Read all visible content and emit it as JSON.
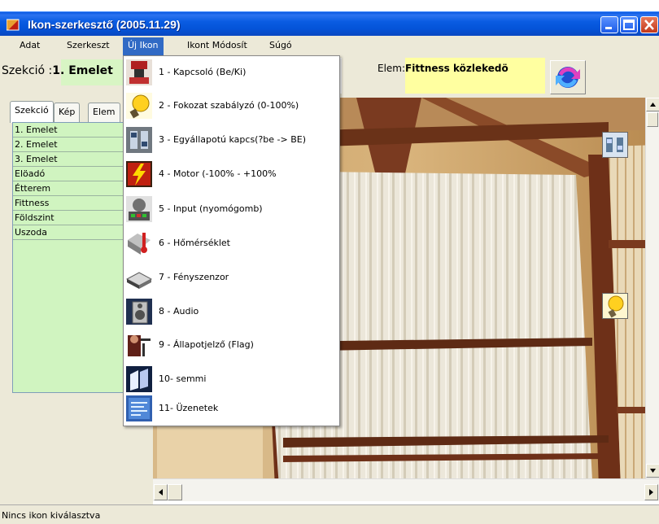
{
  "window": {
    "title": "Ikon-szerkesztő (2005.11.29)"
  },
  "menubar": {
    "items": [
      "Adat",
      "Szerkeszt",
      "Új Ikon",
      "Ikont Módosít",
      "Súgó"
    ]
  },
  "section": {
    "label": "Szekció :",
    "value": "1. Emelet"
  },
  "element": {
    "label": "Elem:",
    "value": "Fittness közlekedö"
  },
  "tabs": [
    "Szekció",
    "Kép",
    "Elem"
  ],
  "section_list": [
    "1. Emelet",
    "2. Emelet",
    "3. Emelet",
    "Elöadó",
    "Étterem",
    "Fittness",
    "Földszint",
    "Uszoda"
  ],
  "new_icon_menu": [
    {
      "label": "1 - Kapcsoló (Be/Ki)",
      "icon": "switch-icon"
    },
    {
      "label": "2 - Fokozat szabályzó (0-100%)",
      "icon": "dimmer-bulb-icon"
    },
    {
      "label": "3 - Egyállapotú kapcs(?be -> BE)",
      "icon": "single-state-switch-icon"
    },
    {
      "label": "4 - Motor (-100% - +100%",
      "icon": "motor-lightning-icon"
    },
    {
      "label": "5 - Input (nyomógomb)",
      "icon": "pushbutton-input-icon"
    },
    {
      "label": "6 - Hőmérséklet",
      "icon": "thermometer-icon"
    },
    {
      "label": "7 - Fényszenzor",
      "icon": "light-sensor-icon"
    },
    {
      "label": "8 - Audio",
      "icon": "speaker-icon"
    },
    {
      "label": "9 - Állapotjelző (Flag)",
      "icon": "flag-status-icon"
    },
    {
      "label": "10- semmi",
      "icon": "nothing-icon"
    },
    {
      "label": "11- Üzenetek",
      "icon": "messages-icon"
    }
  ],
  "status": {
    "text": "Nincs ikon kiválasztva"
  },
  "colors": {
    "titlebar": "#0a5ce2",
    "menu_highlight": "#316ac5",
    "section_box": "#d8f5c4",
    "element_box": "#ffffa0",
    "list_bg": "#d0f4c0"
  }
}
